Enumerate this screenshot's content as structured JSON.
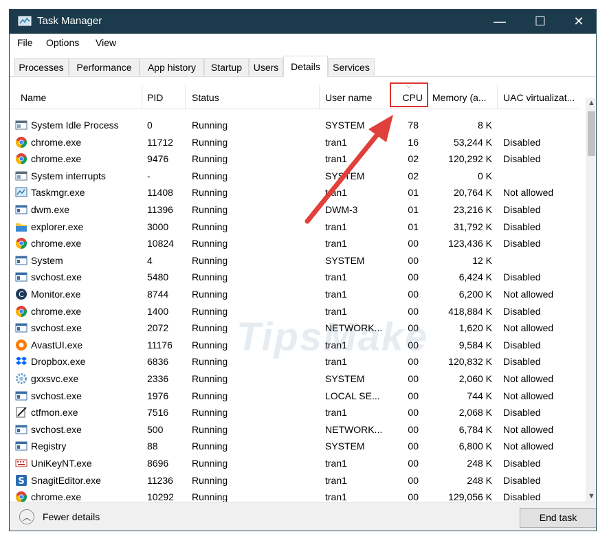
{
  "window": {
    "title": "Task Manager",
    "controls": {
      "minimize": "—",
      "maximize": "☐",
      "close": "✕"
    }
  },
  "menu": [
    "File",
    "Options",
    "View"
  ],
  "tabs": [
    "Processes",
    "Performance",
    "App history",
    "Startup",
    "Users",
    "Details",
    "Services"
  ],
  "active_tab": "Details",
  "columns": [
    "Name",
    "PID",
    "Status",
    "User name",
    "CPU",
    "Memory (a...",
    "UAC virtualizat..."
  ],
  "highlighted_column": "CPU",
  "rows": [
    {
      "name": "System Idle Process",
      "pid": "0",
      "status": "Running",
      "user": "SYSTEM",
      "cpu": "78",
      "memory": "8 K",
      "uac": "",
      "icon": "system-window-icon"
    },
    {
      "name": "chrome.exe",
      "pid": "11712",
      "status": "Running",
      "user": "tran1",
      "cpu": "16",
      "memory": "53,244 K",
      "uac": "Disabled",
      "icon": "chrome-icon"
    },
    {
      "name": "chrome.exe",
      "pid": "9476",
      "status": "Running",
      "user": "tran1",
      "cpu": "02",
      "memory": "120,292 K",
      "uac": "Disabled",
      "icon": "chrome-icon"
    },
    {
      "name": "System interrupts",
      "pid": "-",
      "status": "Running",
      "user": "SYSTEM",
      "cpu": "02",
      "memory": "0 K",
      "uac": "",
      "icon": "system-window-icon"
    },
    {
      "name": "Taskmgr.exe",
      "pid": "11408",
      "status": "Running",
      "user": "tran1",
      "cpu": "01",
      "memory": "20,764 K",
      "uac": "Not allowed",
      "icon": "taskmgr-icon"
    },
    {
      "name": "dwm.exe",
      "pid": "11396",
      "status": "Running",
      "user": "DWM-3",
      "cpu": "01",
      "memory": "23,216 K",
      "uac": "Disabled",
      "icon": "app-window-icon"
    },
    {
      "name": "explorer.exe",
      "pid": "3000",
      "status": "Running",
      "user": "tran1",
      "cpu": "01",
      "memory": "31,792 K",
      "uac": "Disabled",
      "icon": "folder-icon"
    },
    {
      "name": "chrome.exe",
      "pid": "10824",
      "status": "Running",
      "user": "tran1",
      "cpu": "00",
      "memory": "123,436 K",
      "uac": "Disabled",
      "icon": "chrome-icon"
    },
    {
      "name": "System",
      "pid": "4",
      "status": "Running",
      "user": "SYSTEM",
      "cpu": "00",
      "memory": "12 K",
      "uac": "",
      "icon": "app-window-icon"
    },
    {
      "name": "svchost.exe",
      "pid": "5480",
      "status": "Running",
      "user": "tran1",
      "cpu": "00",
      "memory": "6,424 K",
      "uac": "Disabled",
      "icon": "app-window-icon"
    },
    {
      "name": "Monitor.exe",
      "pid": "8744",
      "status": "Running",
      "user": "tran1",
      "cpu": "00",
      "memory": "6,200 K",
      "uac": "Not allowed",
      "icon": "monitor-icon"
    },
    {
      "name": "chrome.exe",
      "pid": "1400",
      "status": "Running",
      "user": "tran1",
      "cpu": "00",
      "memory": "418,884 K",
      "uac": "Disabled",
      "icon": "chrome-icon"
    },
    {
      "name": "svchost.exe",
      "pid": "2072",
      "status": "Running",
      "user": "NETWORK...",
      "cpu": "00",
      "memory": "1,620 K",
      "uac": "Not allowed",
      "icon": "app-window-icon"
    },
    {
      "name": "AvastUI.exe",
      "pid": "11176",
      "status": "Running",
      "user": "tran1",
      "cpu": "00",
      "memory": "9,584 K",
      "uac": "Disabled",
      "icon": "avast-icon"
    },
    {
      "name": "Dropbox.exe",
      "pid": "6836",
      "status": "Running",
      "user": "tran1",
      "cpu": "00",
      "memory": "120,832 K",
      "uac": "Disabled",
      "icon": "dropbox-icon"
    },
    {
      "name": "gxxsvc.exe",
      "pid": "2336",
      "status": "Running",
      "user": "SYSTEM",
      "cpu": "00",
      "memory": "2,060 K",
      "uac": "Not allowed",
      "icon": "gear-icon"
    },
    {
      "name": "svchost.exe",
      "pid": "1976",
      "status": "Running",
      "user": "LOCAL SE...",
      "cpu": "00",
      "memory": "744 K",
      "uac": "Not allowed",
      "icon": "app-window-icon"
    },
    {
      "name": "ctfmon.exe",
      "pid": "7516",
      "status": "Running",
      "user": "tran1",
      "cpu": "00",
      "memory": "2,068 K",
      "uac": "Disabled",
      "icon": "pen-icon"
    },
    {
      "name": "svchost.exe",
      "pid": "500",
      "status": "Running",
      "user": "NETWORK...",
      "cpu": "00",
      "memory": "6,784 K",
      "uac": "Not allowed",
      "icon": "app-window-icon"
    },
    {
      "name": "Registry",
      "pid": "88",
      "status": "Running",
      "user": "SYSTEM",
      "cpu": "00",
      "memory": "6,800 K",
      "uac": "Not allowed",
      "icon": "app-window-icon"
    },
    {
      "name": "UniKeyNT.exe",
      "pid": "8696",
      "status": "Running",
      "user": "tran1",
      "cpu": "00",
      "memory": "248 K",
      "uac": "Disabled",
      "icon": "keyboard-icon"
    },
    {
      "name": "SnagitEditor.exe",
      "pid": "11236",
      "status": "Running",
      "user": "tran1",
      "cpu": "00",
      "memory": "248 K",
      "uac": "Disabled",
      "icon": "snagit-icon"
    },
    {
      "name": "chrome.exe",
      "pid": "10292",
      "status": "Running",
      "user": "tran1",
      "cpu": "00",
      "memory": "129,056 K",
      "uac": "Disabled",
      "icon": "chrome-icon"
    }
  ],
  "footer": {
    "fewer_details": "Fewer details",
    "end_task": "End task"
  },
  "watermark": "TipsMake",
  "colors": {
    "titlebar": "#1b3a4c",
    "highlight": "#d9322f",
    "arrow": "#e0403c"
  }
}
